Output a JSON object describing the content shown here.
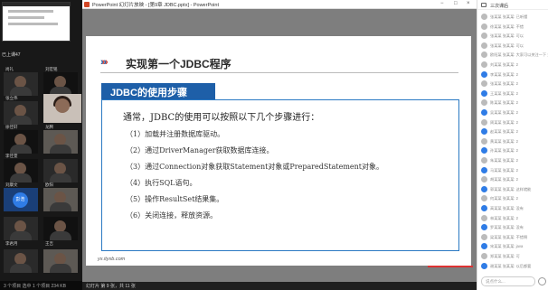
{
  "window": {
    "title": "PowerPoint 幻灯片放映 - [第9章 JDBC.pptx] - PowerPoint",
    "controls": [
      "−",
      "□",
      "×"
    ]
  },
  "left_panel": {
    "status": "已上课47",
    "names": [
      "尚礼",
      "刘宏铭",
      "张立伟",
      "",
      "徐佳轩",
      "龙腾",
      "李佳萱",
      "",
      "刘康文",
      "欧阳",
      "李君月",
      "王吉"
    ],
    "blue_circle_label": "彭浩",
    "bottom": "3 个项目    选中 1 个项目  234 KB"
  },
  "slide": {
    "title": "实现第一个JDBC程序",
    "section": "JDBC的使用步骤",
    "intro": "通常，JDBC的使用可以按照以下几个步骤进行：",
    "steps": [
      "（1）加载并注册数据库驱动。",
      "（2）通过DriverManager获取数据库连接。",
      "（3）通过Connection对象获取Statement对象或PreparedStatement对象。",
      "（4）执行SQL语句。",
      "（5）操作ResultSet结果集。",
      "（6）关闭连接，释放资源。"
    ],
    "watermark": "yx.ityxb.com"
  },
  "statusbar": {
    "text": "幻灯片 第 9 张，共 11 张"
  },
  "chat": {
    "header": "三次课后",
    "messages": [
      "张某某 张某某: 已听懂",
      "徐某某 张某某: 不错",
      "张某某 张某某: 可以",
      "张某某 张某某: 可以",
      "欧阳某 张某某: 大家可以关注一下 对应的方法",
      "刘某某 张某某: 2",
      "李某某 张某某: 2",
      "张某某 张某某: 2",
      "王某某 张某某: 2",
      "陈某某 张某某: 2",
      "吴某某 张某某: 2",
      "周某某 张某某: 2",
      "赵某某 张某某: 2",
      "黄某某 张某某: 2",
      "孙某某 张某某: 2",
      "朱某某 张某某: 2",
      "马某某 张某某: 2",
      "胡某某 张某某: 2",
      "郭某某 张某某: 这样就能",
      "何某某 张某某: 2",
      "高某某 张某某: 没有",
      "林某某 张某某: 2",
      "罗某某 张某某: 没有",
      "梁某某 张某某: 不错啊",
      "宋某某 张某某: java",
      "郑某某 张某某: 可",
      "谢某某 张某某: 以后都要"
    ],
    "input_placeholder": "说点什么..."
  },
  "colors": {
    "chevron": [
      "#1e5fa8",
      "#d33a2c",
      "#1e5fa8",
      "#d33a2c"
    ],
    "section_bg": "#1e5fa8",
    "box_border": "#2a79c3"
  }
}
